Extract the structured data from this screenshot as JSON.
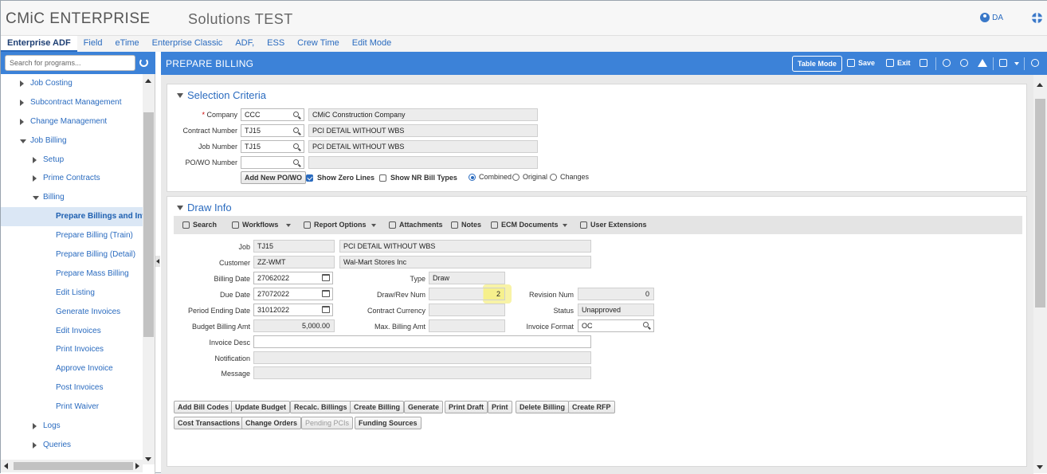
{
  "app": {
    "title": "CMiC ENTERPRISE",
    "environment": "Solutions TEST",
    "user_initials": "DA"
  },
  "nav_tabs": [
    "Enterprise ADF",
    "Field",
    "eTime",
    "Enterprise Classic",
    "ADF,",
    "ESS",
    "Crew Time",
    "Edit Mode"
  ],
  "sidebar": {
    "search_placeholder": "Search for programs...",
    "items": [
      {
        "label": "Job Costing",
        "level": 1,
        "expand": "collapsed"
      },
      {
        "label": "Subcontract Management",
        "level": 1,
        "expand": "collapsed"
      },
      {
        "label": "Change Management",
        "level": 1,
        "expand": "collapsed"
      },
      {
        "label": "Job Billing",
        "level": 1,
        "expand": "expanded"
      },
      {
        "label": "Setup",
        "level": 2,
        "expand": "collapsed"
      },
      {
        "label": "Prime Contracts",
        "level": 2,
        "expand": "collapsed"
      },
      {
        "label": "Billing",
        "level": 2,
        "expand": "expanded"
      },
      {
        "label": "Prepare Billings and Invo",
        "level": 3,
        "selected": true
      },
      {
        "label": "Prepare Billing (Train)",
        "level": 3
      },
      {
        "label": "Prepare Billing (Detail)",
        "level": 3
      },
      {
        "label": "Prepare Mass Billing",
        "level": 3
      },
      {
        "label": "Edit Listing",
        "level": 3
      },
      {
        "label": "Generate Invoices",
        "level": 3
      },
      {
        "label": "Edit Invoices",
        "level": 3
      },
      {
        "label": "Print Invoices",
        "level": 3
      },
      {
        "label": "Approve Invoice",
        "level": 3
      },
      {
        "label": "Post Invoices",
        "level": 3
      },
      {
        "label": "Print Waiver",
        "level": 3
      },
      {
        "label": "Logs",
        "level": 2,
        "expand": "collapsed"
      },
      {
        "label": "Queries",
        "level": 2,
        "expand": "collapsed"
      }
    ]
  },
  "header": {
    "title": "PREPARE BILLING",
    "table_mode": "Table Mode",
    "save": "Save",
    "exit": "Exit"
  },
  "selection": {
    "title": "Selection Criteria",
    "company_label": "Company",
    "company_code": "CCC",
    "company_name": "CMiC Construction Company",
    "contract_label": "Contract Number",
    "contract_code": "TJ15",
    "contract_name": "PCI DETAIL WITHOUT WBS",
    "job_label": "Job Number",
    "job_code": "TJ15",
    "job_name": "PCI DETAIL WITHOUT WBS",
    "powo_label": "PO/WO Number",
    "powo_code": "",
    "powo_name": "",
    "add_powo": "Add New PO/WO",
    "show_zero_lines": "Show Zero Lines",
    "show_zero_lines_checked": true,
    "show_nr_bill_types": "Show NR Bill Types",
    "show_nr_bill_types_checked": false,
    "view_options": [
      "Combined",
      "Original",
      "Changes"
    ],
    "view_selected": "Combined"
  },
  "draw": {
    "title": "Draw Info",
    "toolbar": [
      "Search",
      "Workflows",
      "Report Options",
      "Attachments",
      "Notes",
      "ECM Documents",
      "User Extensions"
    ],
    "job_label": "Job",
    "job_code": "TJ15",
    "job_name": "PCI DETAIL WITHOUT WBS",
    "customer_label": "Customer",
    "customer_code": "ZZ-WMT",
    "customer_name": "Wal-Mart Stores Inc",
    "billing_date_label": "Billing Date",
    "billing_date": "27062022",
    "type_label": "Type",
    "type": "Draw",
    "due_date_label": "Due Date",
    "due_date": "27072022",
    "draw_rev_label": "Draw/Rev Num",
    "draw_rev_num": "2",
    "revision_label": "Revision Num",
    "revision_num": "0",
    "period_end_label": "Period Ending Date",
    "period_end": "31012022",
    "contract_currency_label": "Contract Currency",
    "contract_currency": "",
    "status_label": "Status",
    "status": "Unapproved",
    "budget_label": "Budget Billing Amt",
    "budget": "5,000.00",
    "max_billing_label": "Max. Billing Amt",
    "max_billing": "",
    "invoice_format_label": "Invoice Format",
    "invoice_format": "OC",
    "invoice_desc_label": "Invoice Desc",
    "invoice_desc": "",
    "notification_label": "Notification",
    "notification": "",
    "message_label": "Message",
    "message": "",
    "buttons_row1": [
      "Add Bill Codes",
      "Update Budget",
      "Recalc. Billings",
      "Create Billing",
      "Generate",
      "Print Draft",
      "Print",
      "Delete Billing",
      "Create RFP"
    ],
    "buttons_row2": [
      "Cost Transactions",
      "Change Orders",
      "Pending PCIs",
      "Funding Sources"
    ],
    "disabled_buttons": [
      "Pending PCIs"
    ]
  }
}
